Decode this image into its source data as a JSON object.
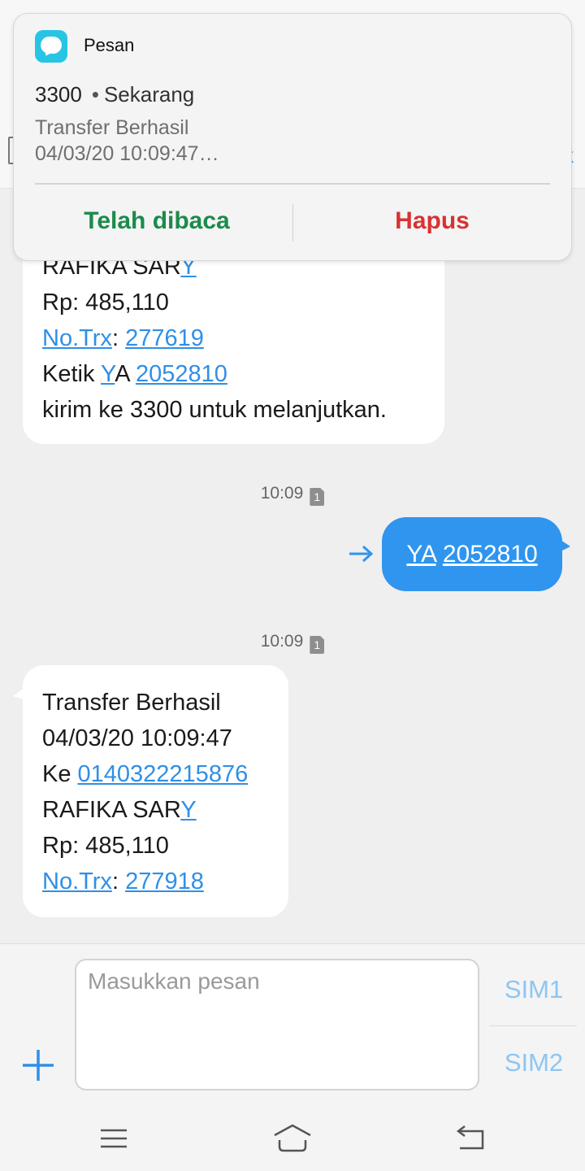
{
  "header": {
    "right_fragment": "k"
  },
  "notification": {
    "app_name": "Pesan",
    "sender": "3300",
    "time": "Sekarang",
    "preview_line1": "Transfer Berhasil",
    "preview_line2": "04/03/20 10:09:47…",
    "action_read": "Telah dibaca",
    "action_delete": "Hapus"
  },
  "messages": {
    "incoming_1": {
      "name_plain": "RAFIKA SAR",
      "name_link": "Y",
      "amount": "Rp: 485,110",
      "trx_label": "No.Trx",
      "trx_sep": ": ",
      "trx_value": "277619",
      "reply_prefix": "Ketik ",
      "reply_link_y": "Y",
      "reply_a": "A ",
      "reply_code": "2052810",
      "instruction": "kirim ke 3300 untuk melanjutkan."
    },
    "time_1": "10:09",
    "sim_badge_1": "1",
    "outgoing": {
      "word": "YA",
      "code": "2052810"
    },
    "time_2": "10:09",
    "sim_badge_2": "1",
    "incoming_2": {
      "title": "Transfer Berhasil",
      "datetime": "04/03/20 10:09:47",
      "to_prefix": "Ke ",
      "account": "0140322215876",
      "name_plain": "RAFIKA SAR",
      "name_link": "Y",
      "amount": "Rp: 485,110",
      "trx_label": "No.Trx",
      "trx_sep": ": ",
      "trx_value": "277918"
    }
  },
  "compose": {
    "placeholder": "Masukkan pesan",
    "sim1_label": "SIM1",
    "sim2_label": "SIM2"
  },
  "colors": {
    "accent": "#2f95ee",
    "link": "#2f8fe6",
    "read_action": "#1b8b4b",
    "delete_action": "#d93131"
  }
}
